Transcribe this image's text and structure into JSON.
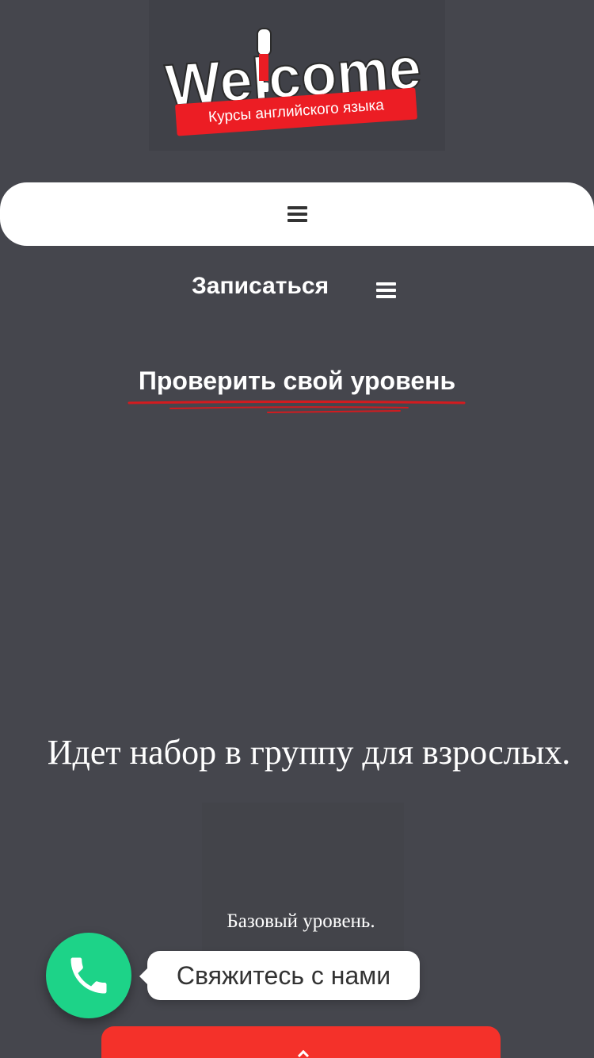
{
  "logo": {
    "wordmark": "Welcome",
    "subtitle": "Курсы английского языка"
  },
  "nav": {
    "menu_icon": "hamburger-icon"
  },
  "header_actions": {
    "signup_label": "Записаться",
    "menu_icon": "hamburger-icon"
  },
  "level_check": {
    "label": "Проверить свой уровень"
  },
  "hero": {
    "title": "Идет набор в группу для взрослых.",
    "subtitle": "Базовый уровень."
  },
  "contact": {
    "label": "Свяжитесь с нами",
    "icon": "phone-icon"
  },
  "colors": {
    "background": "#45464d",
    "accent_red": "#f4312a",
    "call_green": "#1dd388",
    "nav_bg": "#ffffff"
  }
}
